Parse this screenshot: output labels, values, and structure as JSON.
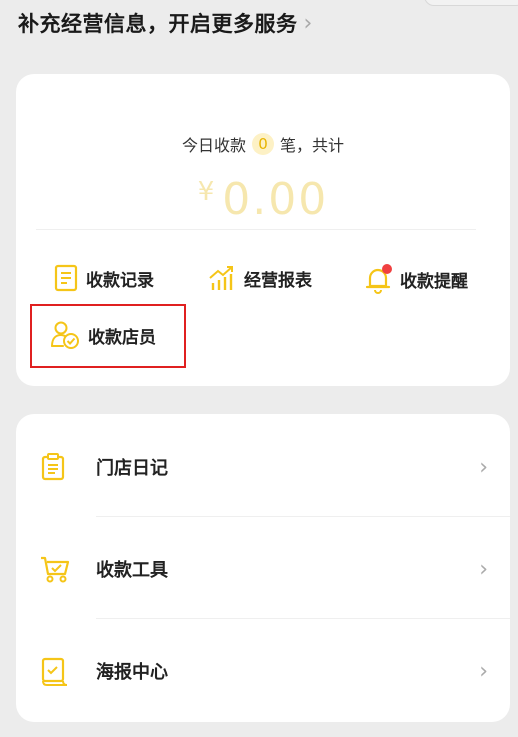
{
  "header": {
    "title": "补充经营信息，开启更多服务",
    "chevron": "›"
  },
  "summary": {
    "today_prefix": "今日收款",
    "today_count": "0",
    "today_suffix": "笔，共计",
    "currency": "¥",
    "amount": "0.00"
  },
  "features": [
    {
      "label": "收款记录",
      "icon": "receipt-icon"
    },
    {
      "label": "经营报表",
      "icon": "growth-chart-icon"
    },
    {
      "label": "收款提醒",
      "icon": "bell-icon",
      "has_dot": true
    },
    {
      "label": "收款店员",
      "icon": "staff-icon",
      "highlighted": true
    }
  ],
  "menu": [
    {
      "label": "门店日记",
      "icon": "clipboard-icon"
    },
    {
      "label": "收款工具",
      "icon": "cart-icon"
    },
    {
      "label": "海报中心",
      "icon": "poster-icon"
    }
  ],
  "colors": {
    "accent": "#f5c518",
    "amount_placeholder": "#f6e7ae",
    "badge_bg": "#fdf1c5",
    "notification_dot": "#f04040",
    "highlight_border": "#e02020"
  }
}
